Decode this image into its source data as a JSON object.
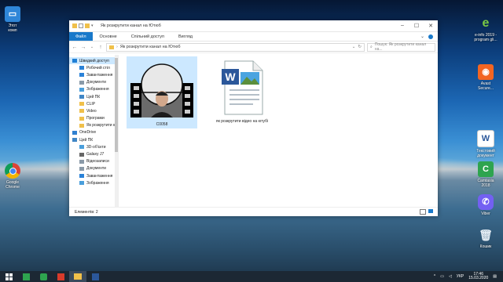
{
  "desktop": {
    "left_icons": [
      {
        "label": "Этот\nкомп"
      },
      {
        "label": "Google\nChrome"
      }
    ],
    "right_icons": [
      {
        "label": "e-info 2019 -\nprogram gli..."
      },
      {
        "label": "Avast\nSecure..."
      },
      {
        "label": "Текстовий\nдокумент"
      },
      {
        "label": "Camtasia\n2018"
      },
      {
        "label": "Viber"
      },
      {
        "label": "Кошик"
      }
    ]
  },
  "window": {
    "title": "Як розкрутити канал на Ютюб",
    "ribbon": {
      "file": "Файл",
      "tabs": [
        "Основне",
        "Спільний доступ",
        "Вигляд"
      ]
    },
    "address": "Як розкрутити канал на Ютюб",
    "search_placeholder": "Пошук: Як розкрутити канал на...",
    "nav": [
      {
        "label": "Швидкий доступ",
        "level": 1,
        "active": true,
        "color": "#1e7fd6"
      },
      {
        "label": "Робочий стіл",
        "level": 2,
        "color": "#2a82d8"
      },
      {
        "label": "Завантаження",
        "level": 2,
        "color": "#2a82d8"
      },
      {
        "label": "Документи",
        "level": 2,
        "color": "#8a9aa8"
      },
      {
        "label": "Зображення",
        "level": 2,
        "color": "#4a9fdc"
      },
      {
        "label": "Цей ПК",
        "level": 2,
        "color": "#3f86c6"
      },
      {
        "label": "CLIP",
        "level": 2,
        "color": "#f0c04a"
      },
      {
        "label": "Video",
        "level": 2,
        "color": "#f0c04a"
      },
      {
        "label": "Програми",
        "level": 2,
        "color": "#f0c04a"
      },
      {
        "label": "Як розкрутити к",
        "level": 2,
        "color": "#f0c04a"
      },
      {
        "label": "OneDrive",
        "level": 1,
        "color": "#2f7fd0"
      },
      {
        "label": "Цей ПК",
        "level": 1,
        "color": "#3f86c6"
      },
      {
        "label": "3D-об'єкти",
        "level": 2,
        "color": "#4a9fdc"
      },
      {
        "label": "Galaxy J7",
        "level": 2,
        "color": "#666666"
      },
      {
        "label": "Відеозаписи",
        "level": 2,
        "color": "#8a9aa8"
      },
      {
        "label": "Документи",
        "level": 2,
        "color": "#8a9aa8"
      },
      {
        "label": "Завантаження",
        "level": 2,
        "color": "#2a82d8"
      },
      {
        "label": "Зображення",
        "level": 2,
        "color": "#4a9fdc"
      }
    ],
    "files": [
      {
        "name": "C0058",
        "type": "video",
        "selected": true
      },
      {
        "name": "як розкрутити відео на ютубі",
        "type": "word",
        "selected": false
      }
    ],
    "status": "Елементів: 2"
  },
  "taskbar": {
    "language": "УКР",
    "time": "17:46",
    "date": "15.03.2020"
  }
}
